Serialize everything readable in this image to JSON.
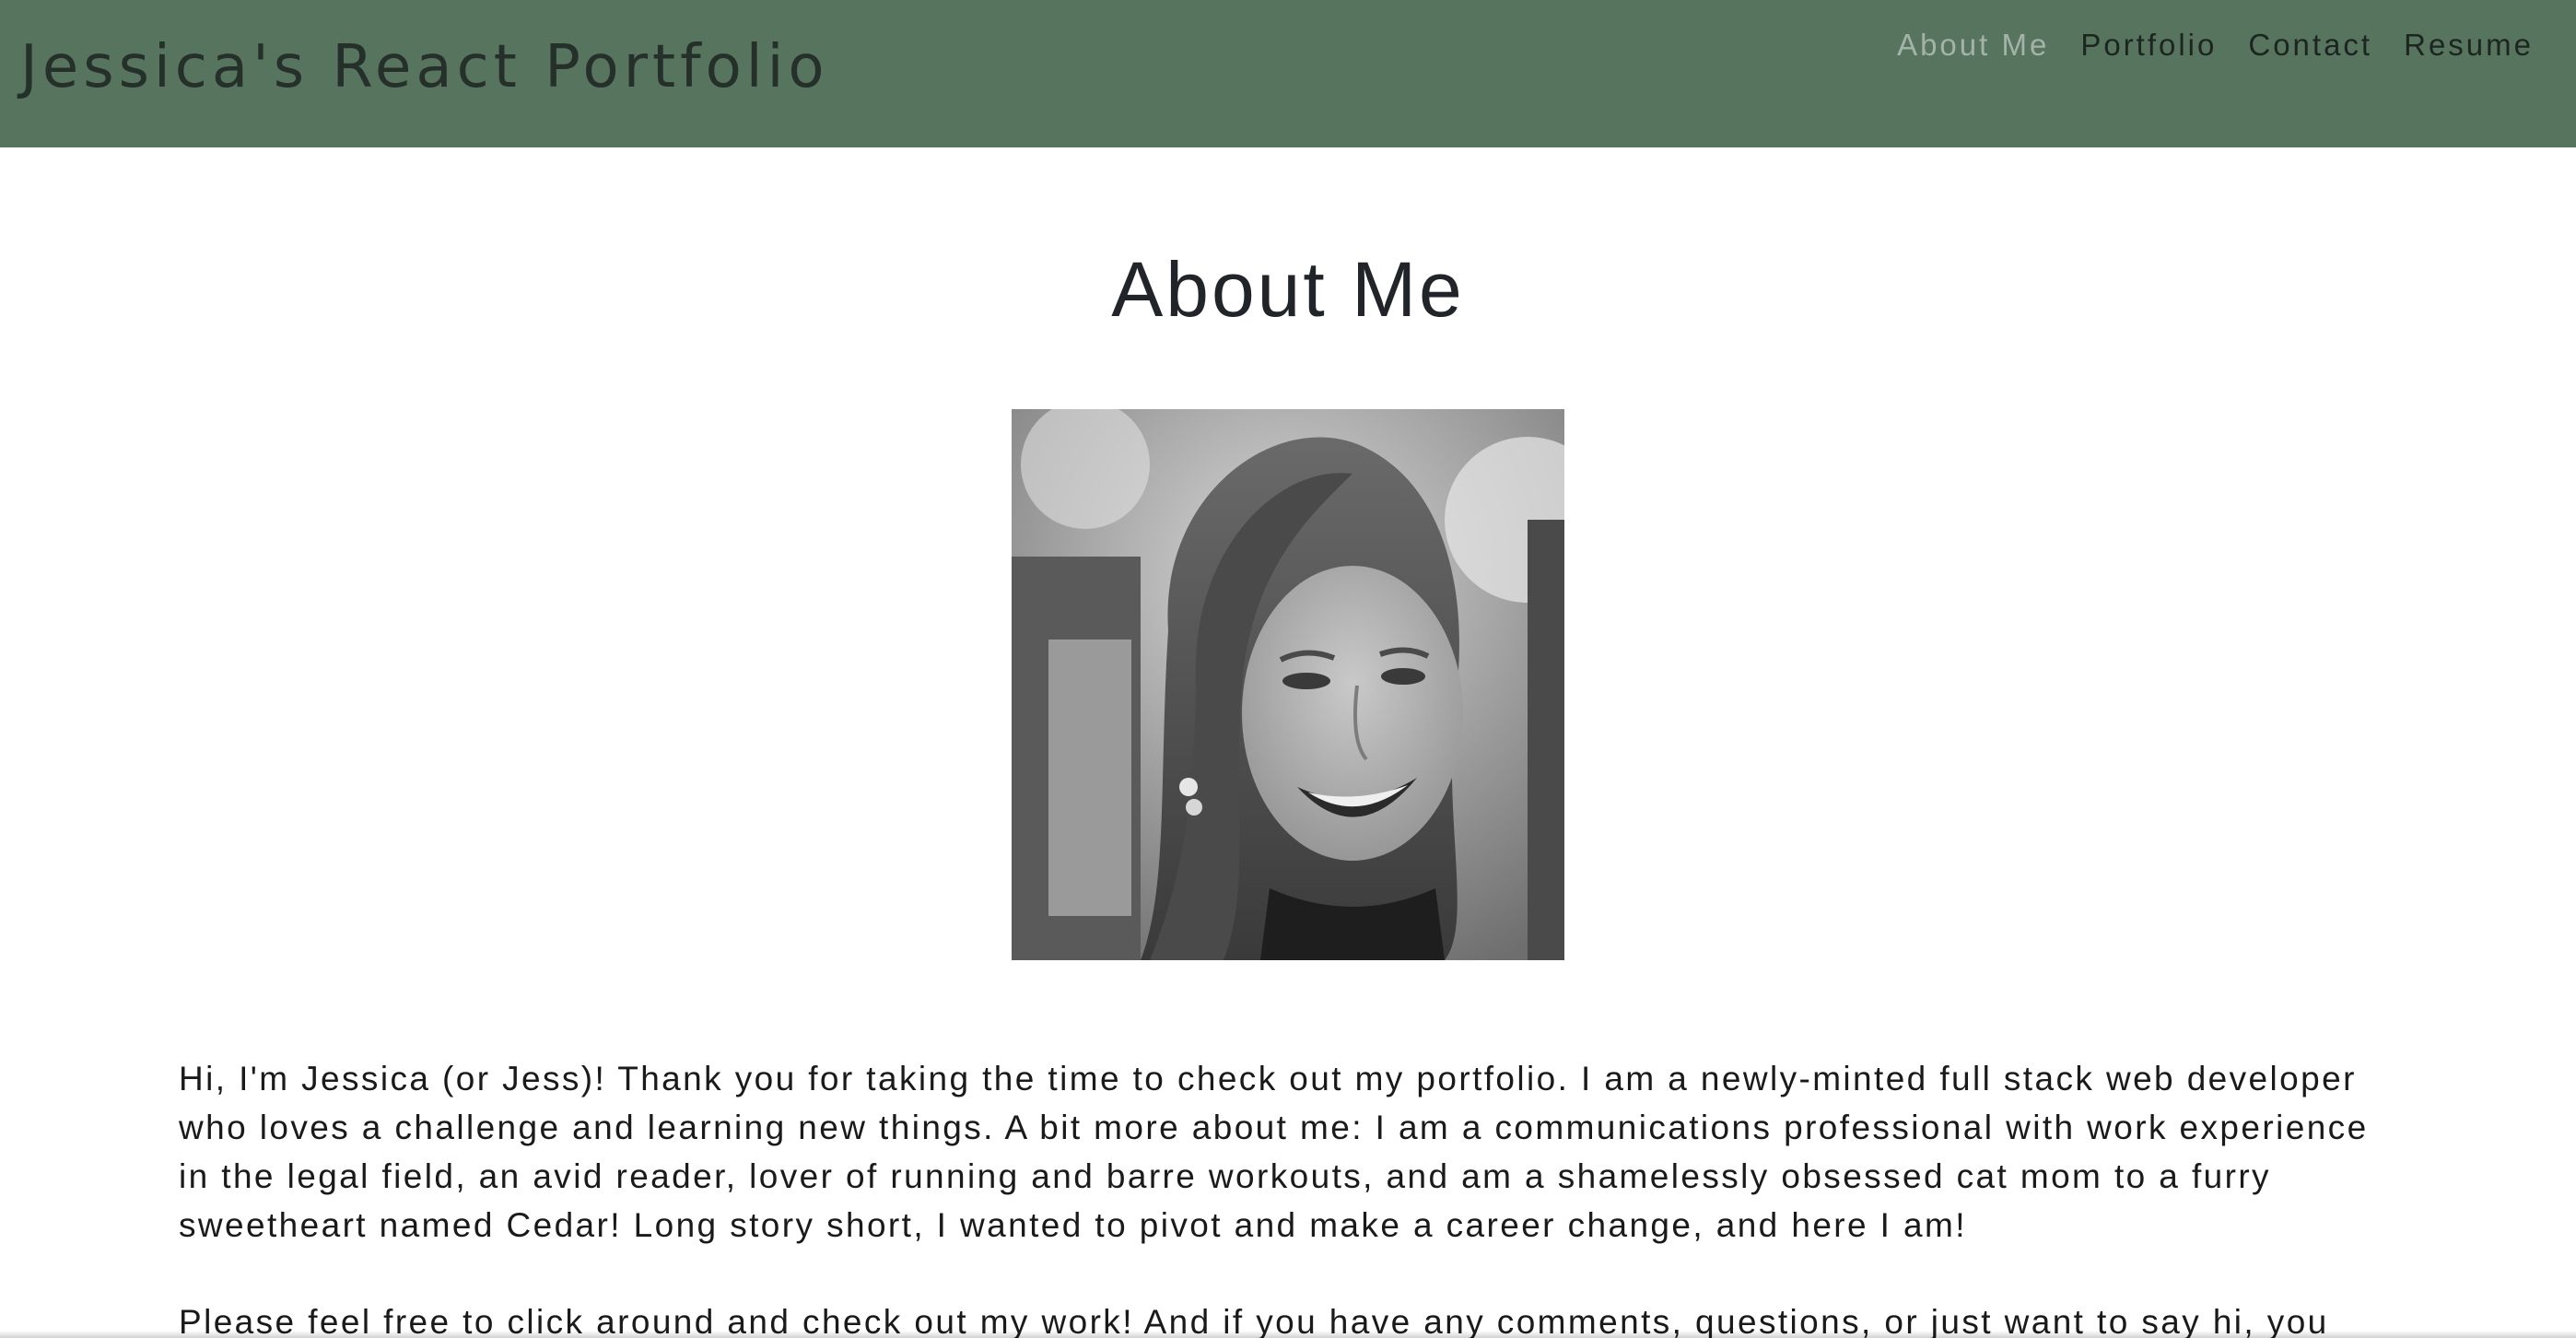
{
  "header": {
    "title": "Jessica's React Portfolio",
    "background_color": "#57745f",
    "nav": [
      {
        "label": "About Me",
        "active": true
      },
      {
        "label": "Portfolio",
        "active": false
      },
      {
        "label": "Contact",
        "active": false
      },
      {
        "label": "Resume",
        "active": false
      }
    ]
  },
  "main": {
    "heading": "About Me",
    "portrait": {
      "kind": "grayscale photo of smiling woman with long hair"
    },
    "paragraphs": [
      "Hi, I'm Jessica (or Jess)! Thank you for taking the time to check out my portfolio. I am a newly-minted full stack web developer who loves a challenge and learning new things. A bit more about me: I am a communications professional with work experience in the legal field, an avid reader, lover of running and barre workouts, and am a shamelessly obsessed cat mom to a furry sweetheart named Cedar! Long story short, I wanted to pivot and make a career change, and here I am!",
      "Please feel free to click around and check out my work! And if you have any comments, questions, or just want to say hi, you"
    ]
  }
}
